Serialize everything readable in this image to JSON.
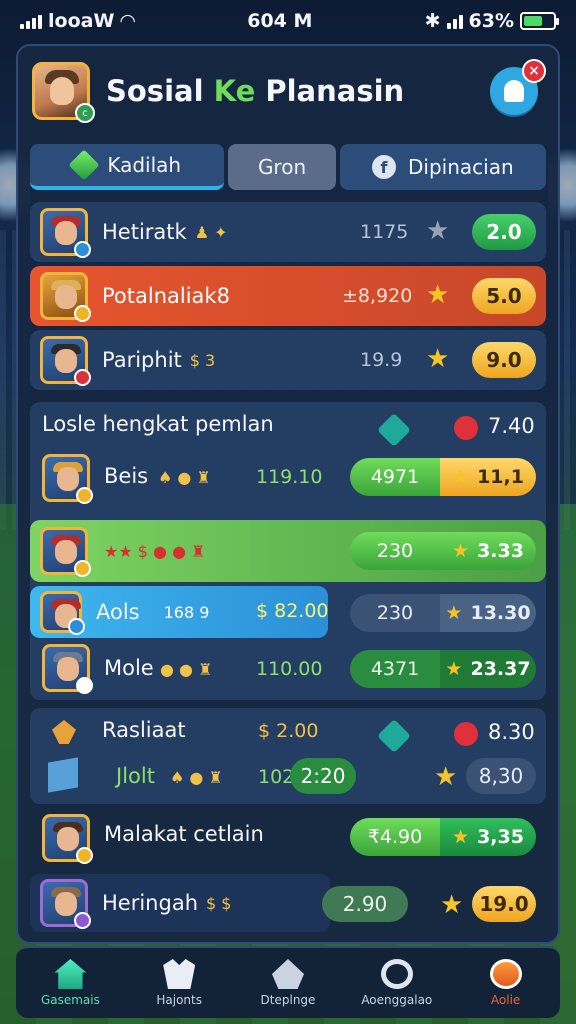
{
  "status_bar": {
    "carrier": "looaW",
    "time": "604 M",
    "battery": "63%",
    "battery_level": 0.63
  },
  "header": {
    "title_part1": "Sosial ",
    "title_accent": "Ke",
    "title_part2": " Planasin",
    "notification_count": "×"
  },
  "tabs": [
    {
      "label": "Kadilah"
    },
    {
      "label": "Gron"
    },
    {
      "label": "Dipinacian",
      "icon_letter": "f"
    }
  ],
  "players": [
    {
      "name": "Hetiratk",
      "deco": "♟ ✦",
      "value": "1175",
      "score": "2.0"
    },
    {
      "name": "Potalnaliak8",
      "deco": "",
      "value": "±8,920",
      "score": "5.0"
    },
    {
      "name": "Pariphit",
      "deco": "$ 3",
      "value": "19.9",
      "score": "9.0"
    }
  ],
  "section1": {
    "title": "Losle hengkat pemlan",
    "right_value": "7.40",
    "rows": [
      {
        "name": "Beis",
        "deco": "♠ ● ♜",
        "value": "119.10",
        "left": "4971",
        "right": "11,1"
      },
      {
        "name": "",
        "deco": "★★ $ ● ● ♜",
        "value": "",
        "left": "230",
        "right": "3.33"
      },
      {
        "name": "Aols",
        "deco": "168 9",
        "value": "$ 82.00",
        "left": "230",
        "right": "13.30"
      },
      {
        "name": "Mole",
        "deco": "● ● ♜",
        "value": "110.00",
        "left": "4371",
        "right": "23.37"
      }
    ]
  },
  "section2": {
    "title": "Rasliaat",
    "money": "$ 2.00",
    "right_value": "8.30",
    "rows": [
      {
        "name": "Jlolt",
        "deco": "♠ ● ♜",
        "value": "102.16",
        "left": "2:20",
        "right": "8,30"
      },
      {
        "name": "Malakat cetlain",
        "deco": "",
        "value": "",
        "left": "₹4.90",
        "right": "3,35"
      },
      {
        "name": "Heringah",
        "deco": "$ $",
        "value": "",
        "left": "2.90",
        "right": "19.0"
      }
    ]
  },
  "nav": [
    {
      "label": "Gasemais",
      "icon": "home-icon"
    },
    {
      "label": "Hajonts",
      "icon": "team-icon"
    },
    {
      "label": "Dteplnge",
      "icon": "rank-icon"
    },
    {
      "label": "Aoenggalao",
      "icon": "ring-icon"
    },
    {
      "label": "Aolie",
      "icon": "profile-icon"
    }
  ]
}
